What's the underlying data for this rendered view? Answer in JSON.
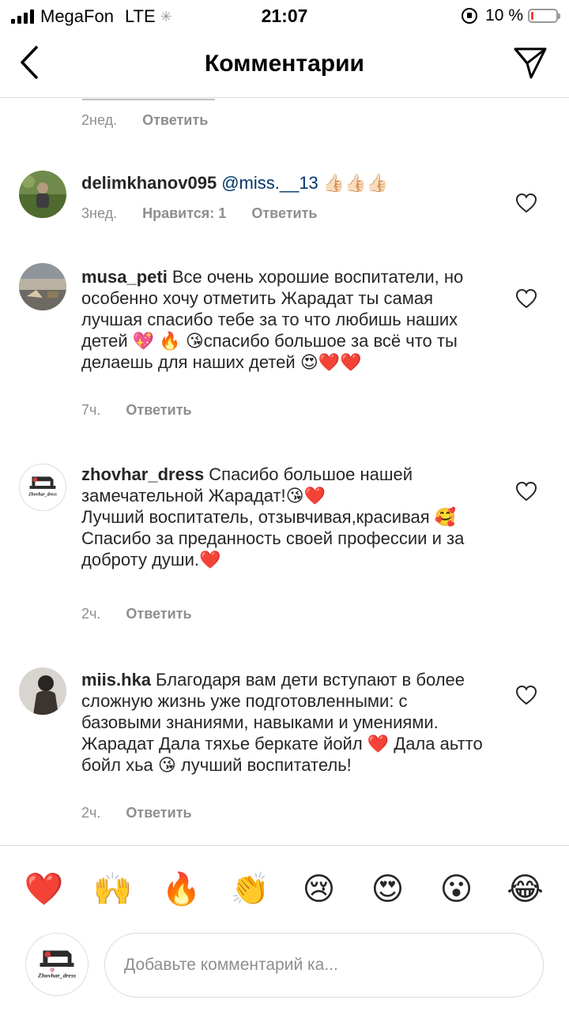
{
  "status_bar": {
    "carrier": "MegaFon",
    "network": "LTE",
    "time": "21:07",
    "battery": "10 %",
    "battery_level": 0.1,
    "battery_color": "#ff3b30"
  },
  "header": {
    "title": "Комментарии"
  },
  "partial": {
    "time": "2нед.",
    "reply": "Ответить"
  },
  "comments": [
    {
      "username": "delimkhanov095",
      "mention": "@miss.__13",
      "text": " 👍🏻👍🏻👍🏻",
      "time": "3нед.",
      "likes": "Нравится: 1",
      "reply": "Ответить",
      "avatar_icon": "person-photo-avatar"
    },
    {
      "username": "musa_peti",
      "text": "Все очень хорошие воспитатели, но особенно хочу отметить Жарадат ты самая лучшая спасибо тебе за то что любишь наших детей 💖 🔥 😘спасибо большое за всё что ты делаешь для наших детей 😍❤️❤️",
      "time": "7ч.",
      "reply": "Ответить",
      "avatar_icon": "landscape-avatar"
    },
    {
      "username": "zhovhar_dress",
      "lines": [
        "Спасибо большое нашей замечательной Жарадат!😘❤️",
        "Лучший воспитатель, отзывчивая,красивая 🥰",
        "Спасибо за преданность своей профессии и за доброту души.❤️"
      ],
      "time": "2ч.",
      "reply": "Ответить",
      "avatar_text": "Zhovhar_dress"
    },
    {
      "username": "miis.hka",
      "text": "Благодаря вам дети вступают в более сложную жизнь уже подготовленными: с базовыми знаниями, навыками и умениями.  Жарадат  Дала тяхье беркате  йойл ❤️ Дала аьтто бойл хьа 😘 лучший воспитатель!",
      "time": "2ч.",
      "reply": "Ответить",
      "avatar_icon": "person-dark-avatar"
    }
  ],
  "emoji_bar": [
    "❤️",
    "🙌",
    "🔥",
    "👏",
    "😢",
    "😍",
    "😮",
    "😂"
  ],
  "input": {
    "placeholder": "Добавьте комментарий ка...",
    "avatar_text": "Zhovhar_dress"
  }
}
